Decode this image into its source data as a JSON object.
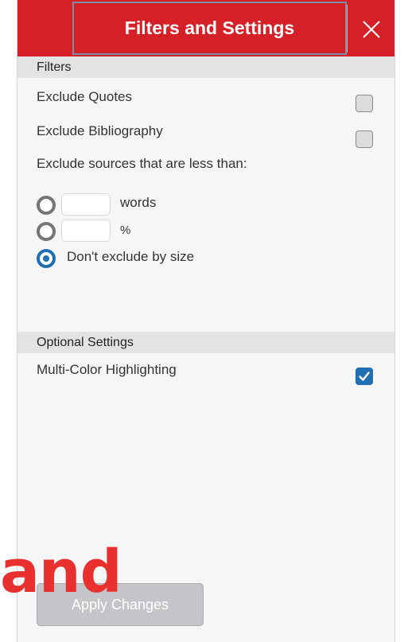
{
  "header": {
    "title": "Filters and Settings",
    "close_icon": "close-icon",
    "background_color": "#d62027"
  },
  "filters": {
    "section_title": "Filters",
    "exclude_quotes": {
      "label": "Exclude Quotes",
      "checked": false
    },
    "exclude_bibliography": {
      "label": "Exclude Bibliography",
      "checked": false
    },
    "size_prompt": "Exclude sources that are less than:",
    "size_options": [
      {
        "unit": "words",
        "value": "",
        "selected": false
      },
      {
        "unit": "%",
        "value": "",
        "selected": false
      },
      {
        "label": "Don't exclude by size",
        "selected": true
      }
    ]
  },
  "optional_settings": {
    "section_title": "Optional Settings",
    "multi_color": {
      "label": "Multi-Color Highlighting",
      "checked": true
    }
  },
  "footer": {
    "apply_label": "Apply Changes"
  },
  "overlay": {
    "text": "and",
    "color": "#e8312f"
  },
  "accent_color": "#1f6fb2"
}
